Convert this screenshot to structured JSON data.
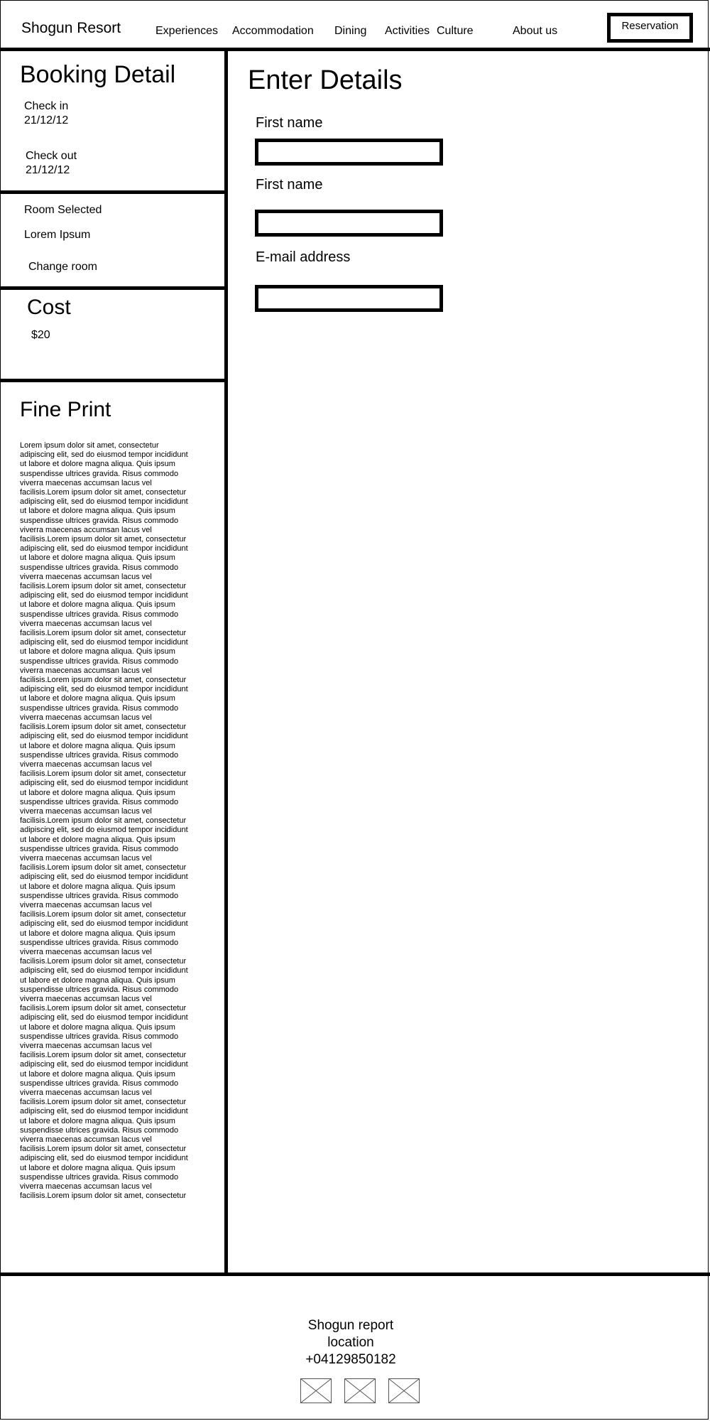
{
  "header": {
    "brand": "Shogun Resort",
    "nav": [
      "Experiences",
      "Accommodation",
      "Dining",
      "Activities",
      "Culture",
      "About us"
    ],
    "reserve_label": "Reservation"
  },
  "booking": {
    "title": "Booking Detail",
    "checkin_label": "Check in",
    "checkin_date": "21/12/12",
    "checkout_label": "Check out",
    "checkout_date": "21/12/12"
  },
  "room": {
    "label": "Room Selected",
    "name": "Lorem Ipsum",
    "change_label": "Change room"
  },
  "cost": {
    "title": "Cost",
    "amount": "$20"
  },
  "fine_print": {
    "title": "Fine Print",
    "text": "Lorem ipsum dolor sit amet, consectetur adipiscing elit, sed do eiusmod tempor incididunt ut labore et dolore magna aliqua. Quis ipsum suspendisse ultrices gravida. Risus commodo viverra maecenas accumsan lacus vel facilisis.Lorem ipsum dolor sit amet, consectetur adipiscing elit, sed do eiusmod tempor incididunt ut labore et dolore magna aliqua. Quis ipsum suspendisse ultrices gravida. Risus commodo viverra maecenas accumsan lacus vel facilisis.Lorem ipsum dolor sit amet, consectetur adipiscing elit, sed do eiusmod tempor incididunt ut labore et dolore magna aliqua. Quis ipsum suspendisse ultrices gravida. Risus commodo viverra maecenas accumsan lacus vel facilisis.Lorem ipsum dolor sit amet, consectetur adipiscing elit, sed do eiusmod tempor incididunt ut labore et dolore magna aliqua. Quis ipsum suspendisse ultrices gravida. Risus commodo viverra maecenas accumsan lacus vel facilisis.Lorem ipsum dolor sit amet, consectetur adipiscing elit, sed do eiusmod tempor incididunt ut labore et dolore magna aliqua. Quis ipsum suspendisse ultrices gravida. Risus commodo viverra maecenas accumsan lacus vel facilisis.Lorem ipsum dolor sit amet, consectetur adipiscing elit, sed do eiusmod tempor incididunt ut labore et dolore magna aliqua. Quis ipsum suspendisse ultrices gravida. Risus commodo viverra maecenas accumsan lacus vel facilisis.Lorem ipsum dolor sit amet, consectetur adipiscing elit, sed do eiusmod tempor incididunt ut labore et dolore magna aliqua. Quis ipsum suspendisse ultrices gravida. Risus commodo viverra maecenas accumsan lacus vel facilisis.Lorem ipsum dolor sit amet, consectetur adipiscing elit, sed do eiusmod tempor incididunt ut labore et dolore magna aliqua. Quis ipsum suspendisse ultrices gravida. Risus commodo viverra maecenas accumsan lacus vel facilisis.Lorem ipsum dolor sit amet, consectetur adipiscing elit, sed do eiusmod tempor incididunt ut labore et dolore magna aliqua. Quis ipsum suspendisse ultrices gravida. Risus commodo viverra maecenas accumsan lacus vel facilisis.Lorem ipsum dolor sit amet, consectetur adipiscing elit, sed do eiusmod tempor incididunt ut labore et dolore magna aliqua. Quis ipsum suspendisse ultrices gravida. Risus commodo viverra maecenas accumsan lacus vel facilisis.Lorem ipsum dolor sit amet, consectetur adipiscing elit, sed do eiusmod tempor incididunt ut labore et dolore magna aliqua. Quis ipsum suspendisse ultrices gravida. Risus commodo viverra maecenas accumsan lacus vel facilisis.Lorem ipsum dolor sit amet, consectetur adipiscing elit, sed do eiusmod tempor incididunt ut labore et dolore magna aliqua. Quis ipsum suspendisse ultrices gravida. Risus commodo viverra maecenas accumsan lacus vel facilisis.Lorem ipsum dolor sit amet, consectetur adipiscing elit, sed do eiusmod tempor incididunt ut labore et dolore magna aliqua. Quis ipsum suspendisse ultrices gravida. Risus commodo viverra maecenas accumsan lacus vel facilisis.Lorem ipsum dolor sit amet, consectetur adipiscing elit, sed do eiusmod tempor incididunt ut labore et dolore magna aliqua. Quis ipsum suspendisse ultrices gravida. Risus commodo viverra maecenas accumsan lacus vel facilisis.Lorem ipsum dolor sit amet, consectetur adipiscing elit, sed do eiusmod tempor incididunt ut labore et dolore magna aliqua. Quis ipsum suspendisse ultrices gravida. Risus commodo viverra maecenas accumsan lacus vel facilisis.Lorem ipsum dolor sit amet, consectetur adipiscing elit, sed do eiusmod tempor incididunt ut labore et dolore magna aliqua. Quis ipsum suspendisse ultrices gravida. Risus commodo viverra maecenas accumsan lacus vel facilisis.Lorem ipsum dolor sit amet, consectetur"
  },
  "form": {
    "title": "Enter Details",
    "first_name_label": "First name",
    "first_name_value": "",
    "second_name_label": "First name",
    "second_name_value": "",
    "email_label": "E-mail address",
    "email_value": ""
  },
  "footer": {
    "name": "Shogun report",
    "location": "location",
    "phone": "+04129850182",
    "social_icons": [
      "image-placeholder-icon",
      "image-placeholder-icon",
      "image-placeholder-icon"
    ]
  }
}
